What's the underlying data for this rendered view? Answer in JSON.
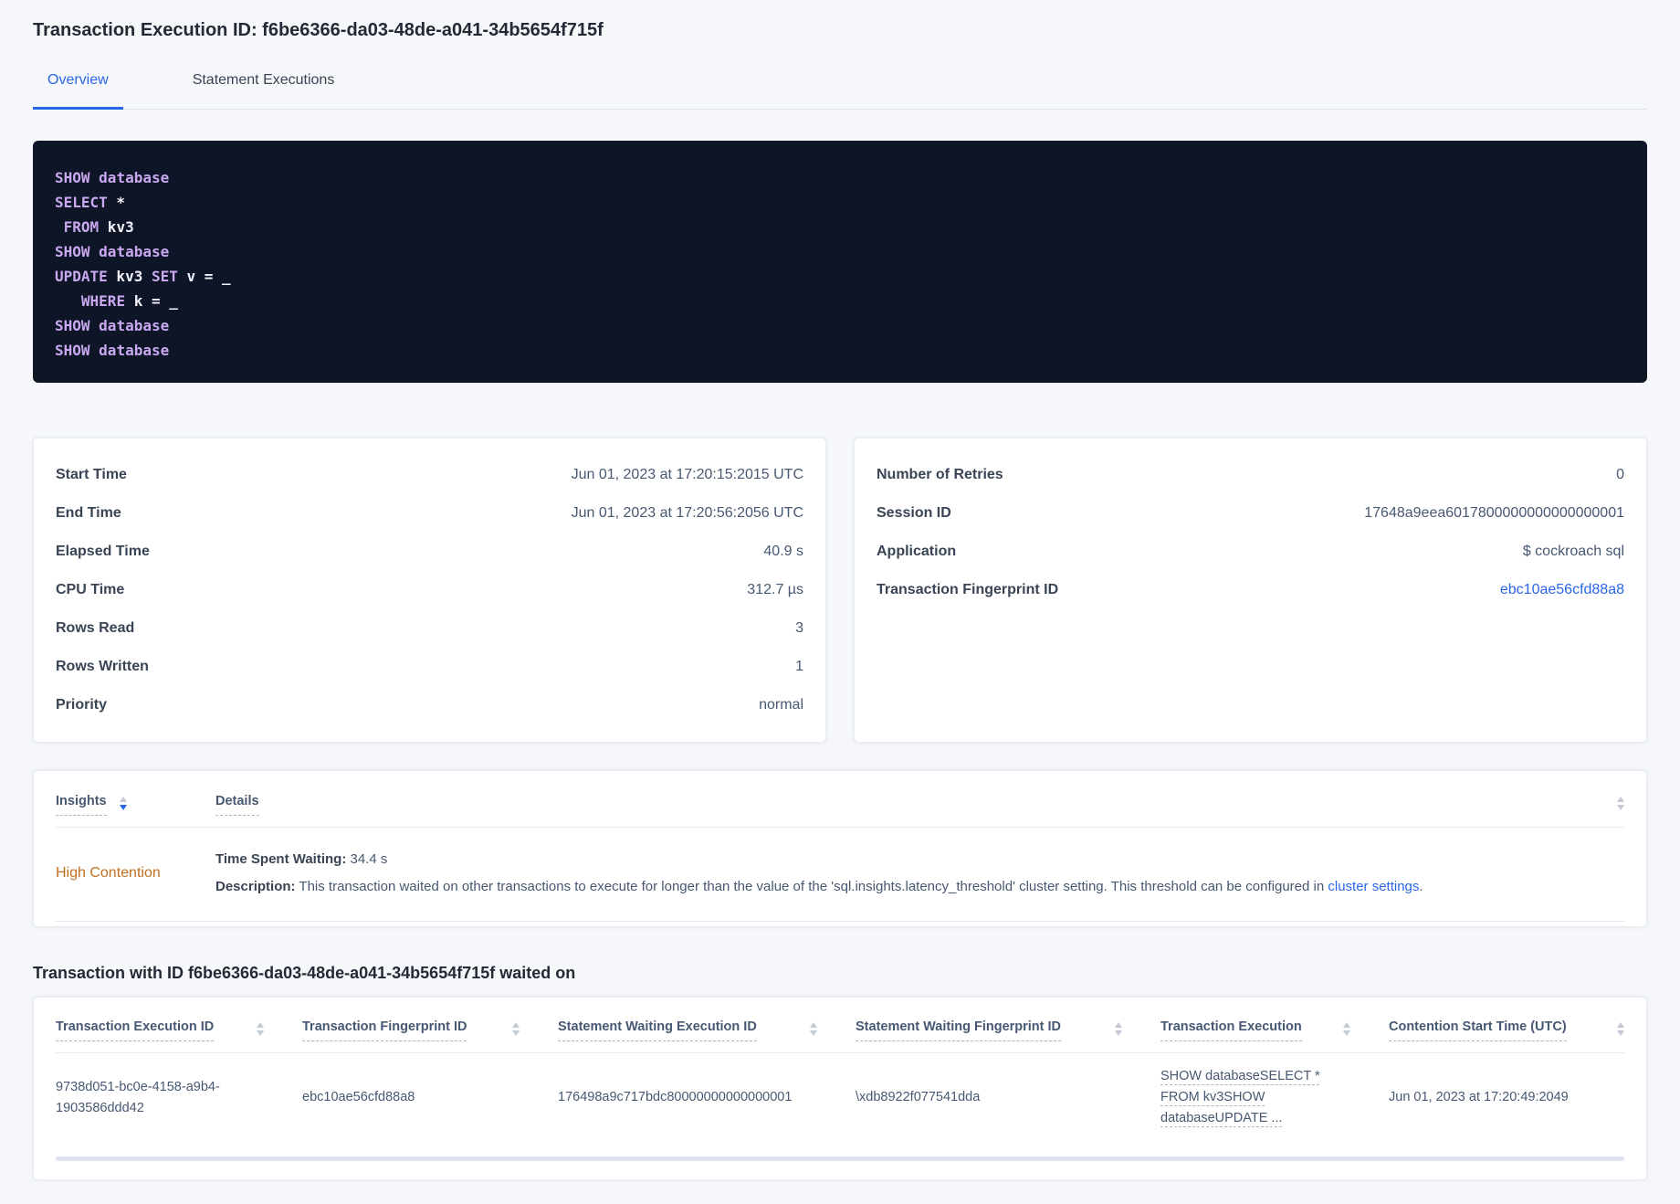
{
  "colors": {
    "accent": "#2a66e8",
    "code-bg": "#0d1527",
    "kw": "#c9a8f0",
    "warn": "#c0701d",
    "pagebg": "#f5f7fa"
  },
  "page": {
    "title": "Transaction Execution ID: f6be6366-da03-48de-a041-34b5654f715f"
  },
  "tabs": {
    "overview": "Overview",
    "statement_executions": "Statement Executions"
  },
  "sql_box": {
    "keywords": [
      "SHOW",
      "database",
      "SELECT",
      "FROM",
      "UPDATE",
      "SET",
      "WHERE"
    ],
    "lines": [
      "SHOW database",
      "SELECT *",
      " FROM kv3",
      "SHOW database",
      "UPDATE kv3 SET v = _",
      "   WHERE k = _",
      "SHOW database",
      "SHOW database"
    ]
  },
  "left_card": {
    "rows": [
      {
        "label": "Start Time",
        "value": "Jun 01, 2023 at 17:20:15:2015 UTC"
      },
      {
        "label": "End Time",
        "value": "Jun 01, 2023 at 17:20:56:2056 UTC"
      },
      {
        "label": "Elapsed Time",
        "value": "40.9 s"
      },
      {
        "label": "CPU Time",
        "value": "312.7 µs"
      },
      {
        "label": "Rows Read",
        "value": "3"
      },
      {
        "label": "Rows Written",
        "value": "1"
      },
      {
        "label": "Priority",
        "value": "normal"
      }
    ]
  },
  "right_card": {
    "retries_label": "Number of Retries",
    "retries_value": "0",
    "session_label": "Session ID",
    "session_value": "17648a9eea6017800000000000000001",
    "application_label": "Application",
    "application_value": "$ cockroach sql",
    "fingerprint_label": "Transaction Fingerprint ID",
    "fingerprint_value": "ebc10ae56cfd88a8"
  },
  "insights": {
    "col_insights": "Insights",
    "col_details": "Details",
    "row": {
      "insight": "High Contention",
      "waiting_label": "Time Spent Waiting:",
      "waiting_value": " 34.4 s",
      "description_label": "Description:",
      "description_text": " This transaction waited on other transactions to execute for longer than the value of the 'sql.insights.latency_threshold' cluster setting. This threshold can be configured in ",
      "description_link": "cluster settings",
      "description_suffix": "."
    }
  },
  "waited_on": {
    "heading": "Transaction with ID f6be6366-da03-48de-a041-34b5654f715f waited on",
    "columns": {
      "c1": "Transaction Execution ID",
      "c2": "Transaction Fingerprint ID",
      "c3": "Statement Waiting Execution ID",
      "c4": "Statement Waiting Fingerprint ID",
      "c5": "Transaction Execution",
      "c6": "Contention Start Time (UTC)"
    },
    "rows": [
      {
        "execution_id": "9738d051-bc0e-4158-a9b4-1903586ddd42",
        "fingerprint_id": "ebc10ae56cfd88a8",
        "stmt_waiting_execution_id": "176498a9c717bdc80000000000000001",
        "stmt_waiting_fingerprint_id": "\\xdb8922f077541dda",
        "transaction_execution": "SHOW databaseSELECT * FROM kv3SHOW databaseUPDATE ...",
        "contention_start": "Jun 01, 2023 at 17:20:49:2049"
      }
    ]
  }
}
